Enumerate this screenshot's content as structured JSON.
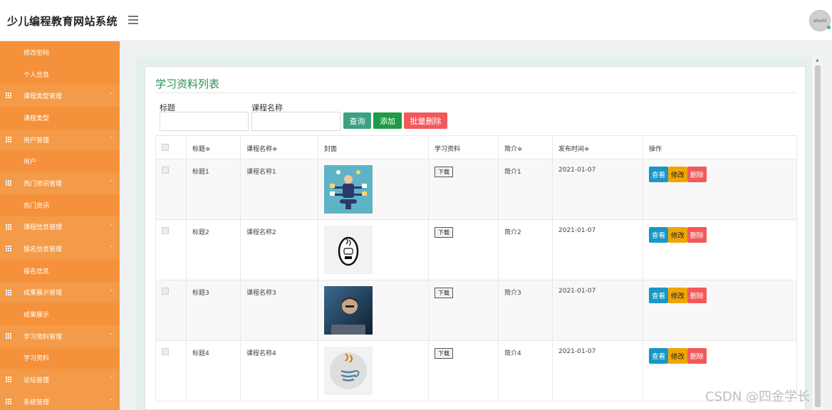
{
  "header": {
    "app_title": "少儿编程教育网站系统",
    "avatar_text": "abadd"
  },
  "sidebar": {
    "items": [
      {
        "label": "修改密码",
        "type": "sub"
      },
      {
        "label": "个人信息",
        "type": "sub"
      },
      {
        "label": "课程类型管理",
        "type": "group"
      },
      {
        "label": "课程类型",
        "type": "sub"
      },
      {
        "label": "用户管理",
        "type": "group"
      },
      {
        "label": "用户",
        "type": "sub"
      },
      {
        "label": "热门资讯管理",
        "type": "group"
      },
      {
        "label": "热门资讯",
        "type": "sub"
      },
      {
        "label": "课程信息管理",
        "type": "group"
      },
      {
        "label": "报名信息管理",
        "type": "group"
      },
      {
        "label": "报名信息",
        "type": "sub"
      },
      {
        "label": "成果展示管理",
        "type": "group"
      },
      {
        "label": "成果展示",
        "type": "sub"
      },
      {
        "label": "学习资料管理",
        "type": "group"
      },
      {
        "label": "学习资料",
        "type": "sub"
      },
      {
        "label": "论坛管理",
        "type": "group"
      },
      {
        "label": "系统管理",
        "type": "group"
      }
    ]
  },
  "panel": {
    "title": "学习资料列表"
  },
  "search": {
    "title_label": "标题",
    "course_label": "课程名称",
    "title_value": "",
    "course_value": "",
    "search_btn": "查询",
    "add_btn": "添加",
    "batch_delete_btn": "批量删除"
  },
  "table": {
    "headers": [
      "标题≑",
      "课程名称≑",
      "封面",
      "学习资料",
      "简介≑",
      "发布时间≑",
      "操作"
    ],
    "rows": [
      {
        "title": "标题1",
        "course": "课程名称1",
        "cover": "illustration-person",
        "download": "下载",
        "intro": "简介1",
        "date": "2021-01-07"
      },
      {
        "title": "标题2",
        "course": "课程名称2",
        "cover": "java-logo-outline",
        "download": "下载",
        "intro": "简介2",
        "date": "2021-01-07"
      },
      {
        "title": "标题3",
        "course": "课程名称3",
        "cover": "photo-man-laptop",
        "download": "下载",
        "intro": "简介3",
        "date": "2021-01-07"
      },
      {
        "title": "标题4",
        "course": "课程名称4",
        "cover": "java-logo-circle",
        "download": "下载",
        "intro": "简介4",
        "date": "2021-01-07"
      }
    ],
    "actions": {
      "view": "查看",
      "edit": "修改",
      "delete": "删除"
    }
  },
  "watermark": "CSDN @四金学长",
  "colors": {
    "sidebar": "#f4913a",
    "accent_green": "#2e8b57",
    "btn_search": "#3aa282",
    "btn_add": "#1e9b45",
    "btn_delete": "#f2595a",
    "btn_view": "#1997c6",
    "btn_edit": "#f0a500"
  }
}
